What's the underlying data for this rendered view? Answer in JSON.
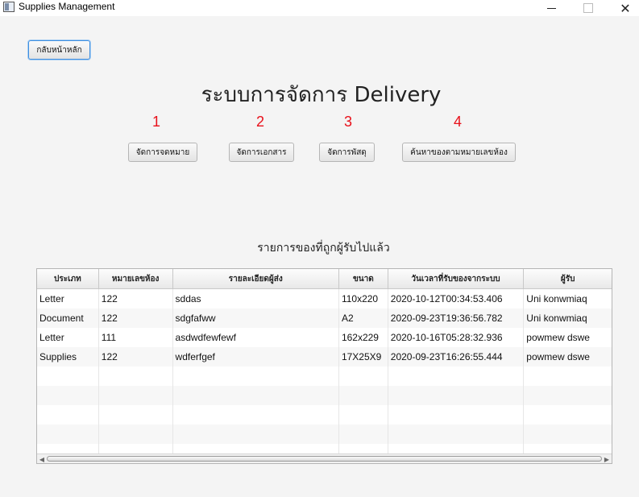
{
  "window": {
    "title": "Supplies Management",
    "close_glyph": "✕"
  },
  "back_button": {
    "label": "กลับหน้าหลัก"
  },
  "main_title": "ระบบการจัดการ Delivery",
  "actions": [
    {
      "number": "1",
      "label": "จัดการจดหมาย"
    },
    {
      "number": "2",
      "label": "จัดการเอกสาร"
    },
    {
      "number": "3",
      "label": "จัดการพัสดุ"
    },
    {
      "number": "4",
      "label": "ค้นหาของตามหมายเลขห้อง"
    }
  ],
  "section_title": "รายการของที่ถูกผู้รับไปแล้ว",
  "table": {
    "columns": [
      "ประเภท",
      "หมายเลขห้อง",
      "รายละเอียดผู้ส่ง",
      "ขนาด",
      "วันเวลาที่รับของจากระบบ",
      "ผู้รับ"
    ],
    "rows": [
      [
        "Letter",
        "122",
        "sddas",
        "110x220",
        "2020-10-12T00:34:53.406",
        "Uni konwmiaq"
      ],
      [
        "Document",
        "122",
        "sdgfafww",
        "A2",
        "2020-09-23T19:36:56.782",
        "Uni konwmiaq"
      ],
      [
        "Letter",
        "111",
        "asdwdfewfewf",
        "162x229",
        "2020-10-16T05:28:32.936",
        "powmew dswe"
      ],
      [
        "Supplies",
        "122",
        "wdferfgef",
        "17X25X9",
        "2020-09-23T16:26:55.444",
        "powmew dswe"
      ]
    ]
  },
  "scroll": {
    "left_glyph": "◀",
    "right_glyph": "▶"
  },
  "colors": {
    "accent_numbers": "#e8101a",
    "focus_border": "#3d8ee0"
  }
}
